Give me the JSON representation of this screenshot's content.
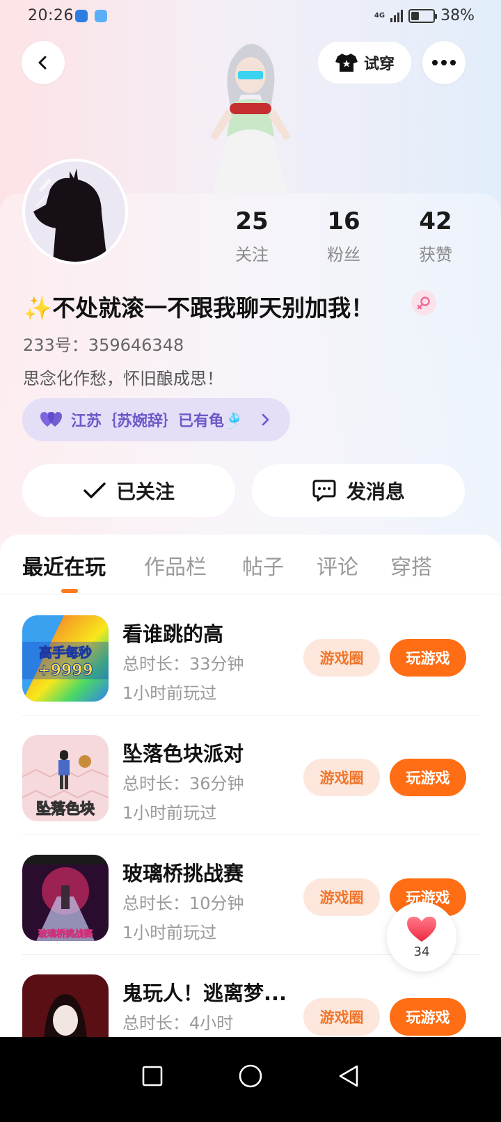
{
  "status_bar": {
    "time": "20:26",
    "network": "4G",
    "battery": "38%",
    "battery_level": 0.38
  },
  "header": {
    "tryon_label": "试穿"
  },
  "stats": [
    {
      "value": "25",
      "label": "关注"
    },
    {
      "value": "16",
      "label": "粉丝"
    },
    {
      "value": "42",
      "label": "获赞"
    }
  ],
  "profile": {
    "nickname": "✨不处就滚一不跟我聊天别加我！",
    "gender_icon": "female-symbol-icon",
    "uid": "233号：359646348",
    "bio": "思念化作愁，怀旧酿成思！",
    "club_tag": "江苏｛苏婉辞｝已有龟🎐"
  },
  "actions": {
    "followed_label": "已关注",
    "message_label": "发消息"
  },
  "tabs": [
    {
      "label": "最近在玩",
      "active": true
    },
    {
      "label": "作品栏",
      "active": false
    },
    {
      "label": "帖子",
      "active": false
    },
    {
      "label": "评论",
      "active": false
    },
    {
      "label": "穿搭",
      "active": false
    }
  ],
  "games": [
    {
      "title": "看谁跳的高",
      "duration": "总时长：33分钟",
      "last_played": "1小时前玩过",
      "thumb_text": "高手每秒\n+9999",
      "circle_label": "游戏圈",
      "play_label": "玩游戏"
    },
    {
      "title": "坠落色块派对",
      "duration": "总时长：36分钟",
      "last_played": "1小时前玩过",
      "thumb_text": "坠落色块",
      "circle_label": "游戏圈",
      "play_label": "玩游戏"
    },
    {
      "title": "玻璃桥挑战赛",
      "duration": "总时长：10分钟",
      "last_played": "1小时前玩过",
      "thumb_text": "玻璃桥挑战赛",
      "circle_label": "游戏圈",
      "play_label": "玩游戏"
    },
    {
      "title": "鬼玩人！逃离梦...",
      "duration": "总时长：4小时",
      "last_played": "",
      "thumb_text": "",
      "circle_label": "游戏圈",
      "play_label": "玩游戏"
    }
  ],
  "float_like": {
    "count": "34"
  },
  "colors": {
    "accent": "#ff6d14",
    "accent_soft": "#fde7dc",
    "club_purple": "#6c58c8"
  }
}
